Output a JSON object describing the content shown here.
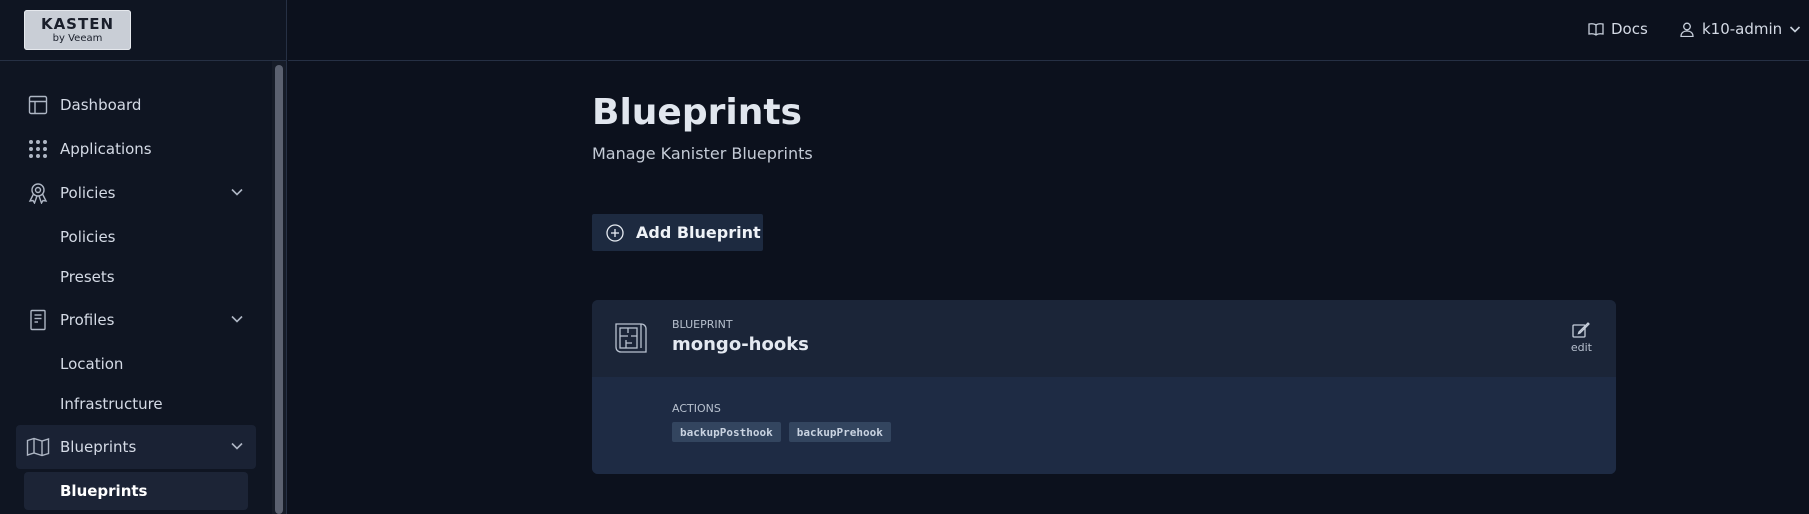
{
  "brand": {
    "line1": "KASTEN",
    "line2": "by Veeam"
  },
  "topbar": {
    "docs_label": "Docs",
    "user_label": "k10-admin"
  },
  "sidebar": {
    "items": [
      {
        "label": "Dashboard",
        "icon": "dashboard-icon"
      },
      {
        "label": "Applications",
        "icon": "grid-icon"
      },
      {
        "label": "Policies",
        "icon": "award-icon",
        "expanded": true
      },
      {
        "label": "Policies",
        "sub": true
      },
      {
        "label": "Presets",
        "sub": true
      },
      {
        "label": "Profiles",
        "icon": "document-icon",
        "expanded": true
      },
      {
        "label": "Location",
        "sub": true
      },
      {
        "label": "Infrastructure",
        "sub": true
      },
      {
        "label": "Blueprints",
        "icon": "map-icon",
        "expanded": true
      },
      {
        "label": "Blueprints",
        "sub": true,
        "active": true
      }
    ]
  },
  "main": {
    "title": "Blueprints",
    "subtitle": "Manage Kanister Blueprints",
    "add_button": "Add Blueprint",
    "blueprint": {
      "kicker": "BLUEPRINT",
      "name": "mongo-hooks",
      "edit_label": "edit",
      "actions_label": "ACTIONS",
      "actions": [
        "backupPosthook",
        "backupPrehook"
      ]
    }
  },
  "colors": {
    "background": "#0c111d",
    "card": "#1a263d",
    "tag": "#33455f"
  }
}
